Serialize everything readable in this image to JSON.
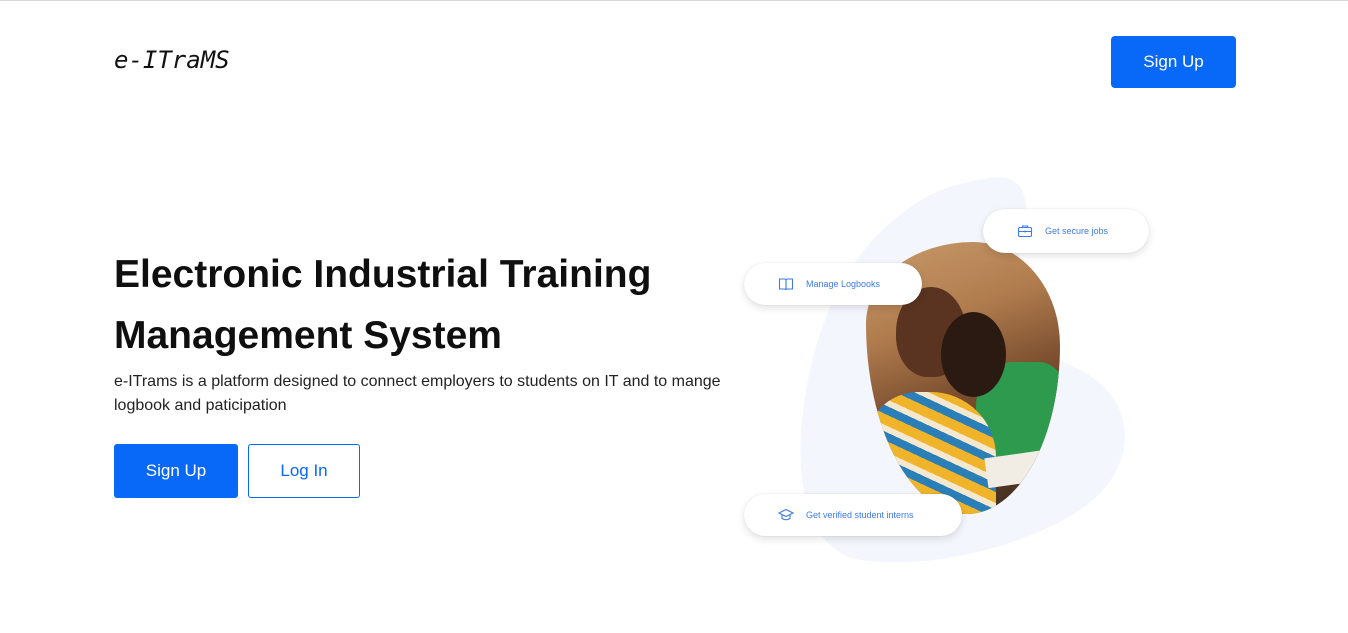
{
  "header": {
    "logo": "e-ITraMS",
    "signup_label": "Sign Up"
  },
  "hero": {
    "title": "Electronic Industrial Training Management System",
    "description": "e-ITrams is a platform designed to connect employers to students on IT and to mange logbook and paticipation",
    "signup_label": "Sign Up",
    "login_label": "Log In"
  },
  "illustration": {
    "badges": [
      {
        "label": "Manage Logbooks",
        "icon": "book-icon"
      },
      {
        "label": "Get secure jobs",
        "icon": "briefcase-icon"
      },
      {
        "label": "Get verified student interns",
        "icon": "graduation-cap-icon"
      }
    ]
  },
  "colors": {
    "accent": "#0868f8",
    "badge_text": "#3d7be6",
    "blob": "#f3f7fd"
  }
}
